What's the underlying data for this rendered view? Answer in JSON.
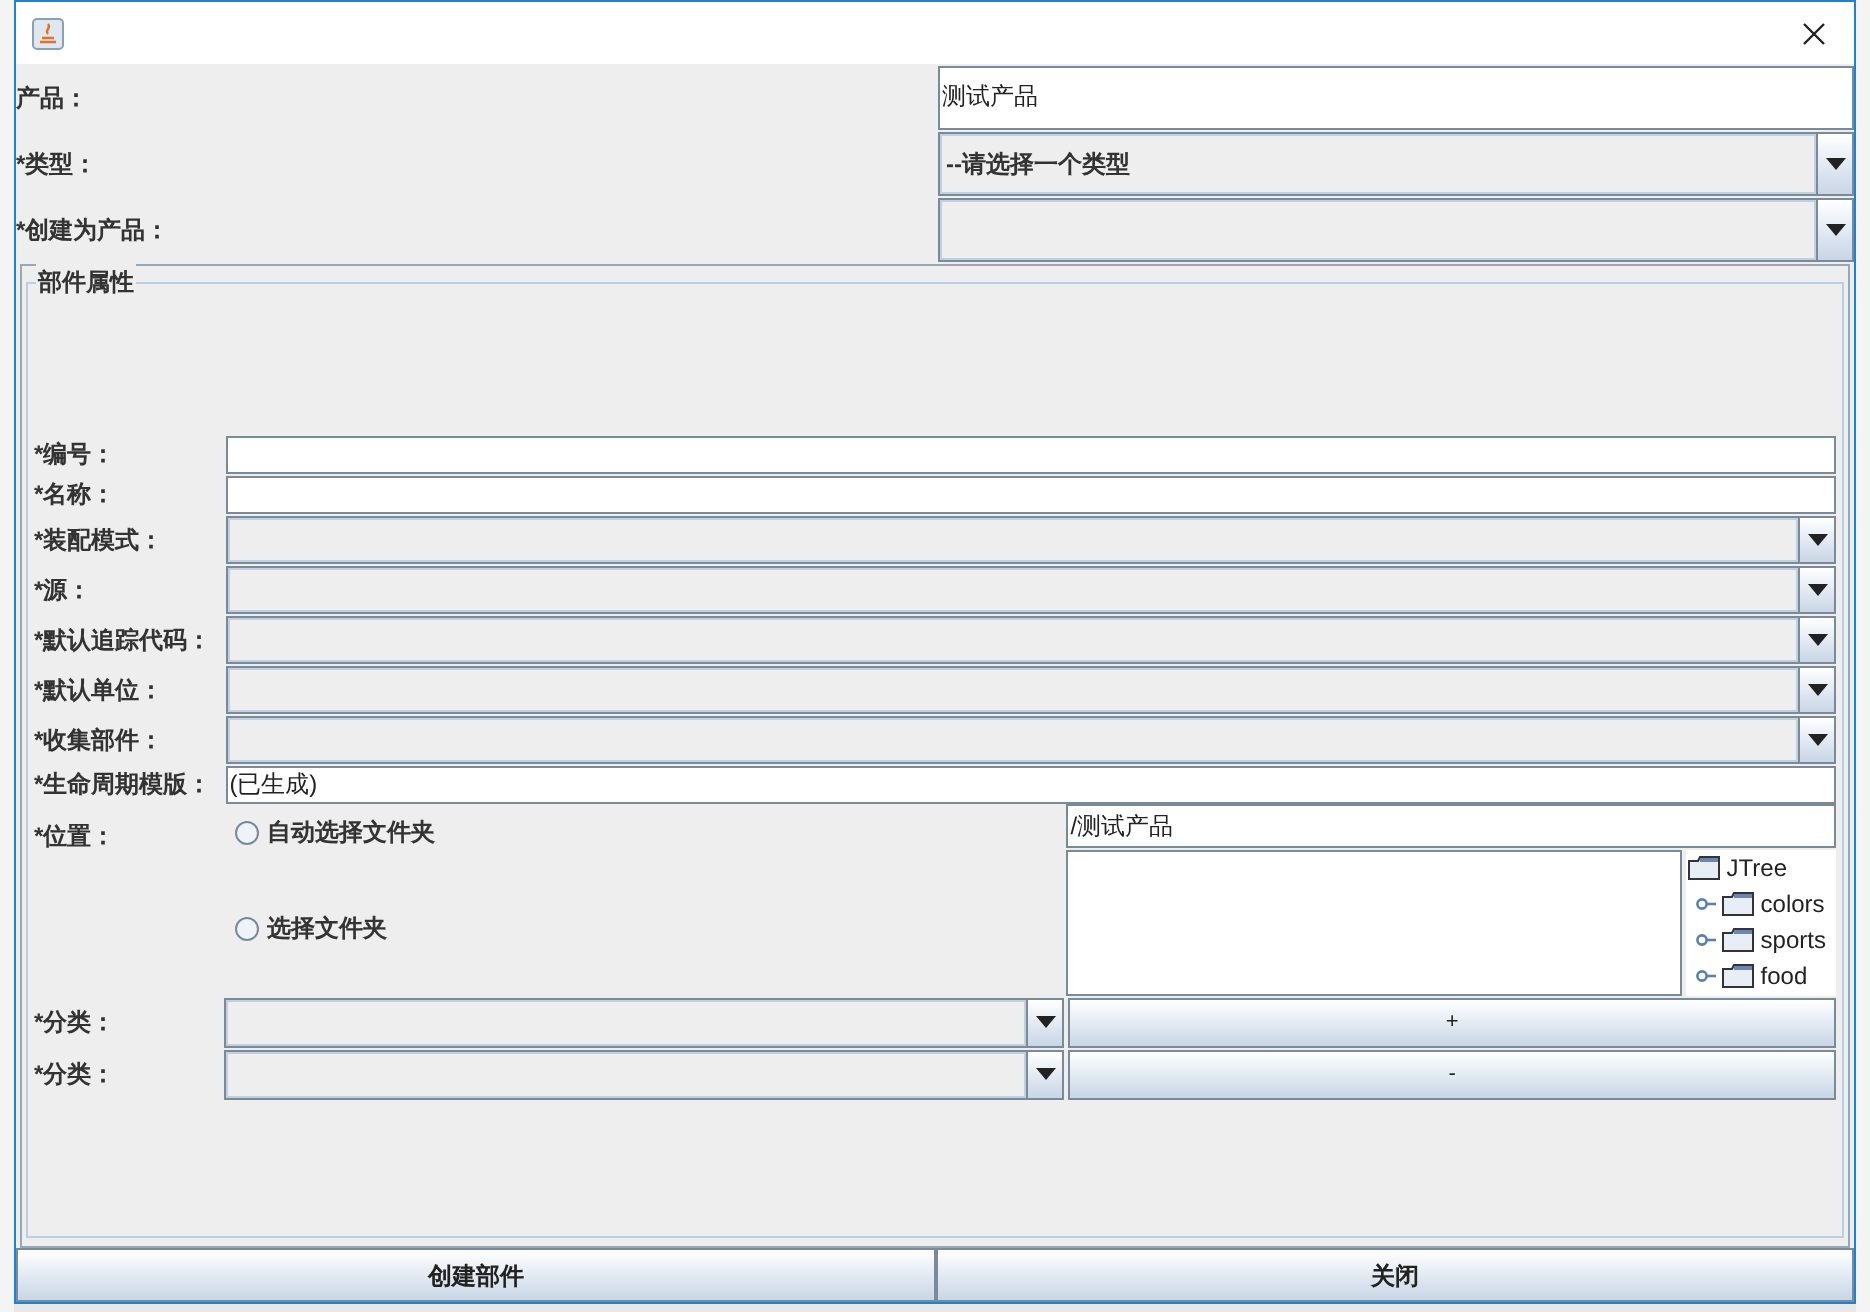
{
  "header_fields": [
    {
      "kind": "text",
      "label": "产品：",
      "value": "测试产品"
    },
    {
      "kind": "combo",
      "label": "*类型：",
      "value": "--请选择一个类型"
    },
    {
      "kind": "combo",
      "label": "*创建为产品："
    }
  ],
  "panel": {
    "title": "部件属性",
    "fields": [
      {
        "kind": "text",
        "label": "*编号："
      },
      {
        "kind": "text",
        "label": "*名称："
      },
      {
        "kind": "combo",
        "label": "*装配模式："
      },
      {
        "kind": "combo",
        "label": "*源："
      },
      {
        "kind": "combo",
        "label": "*默认追踪代码："
      },
      {
        "kind": "combo",
        "label": "*默认单位："
      },
      {
        "kind": "combo",
        "label": "*收集部件："
      },
      {
        "kind": "text",
        "label": "*生命周期模版：",
        "value": "(已生成)"
      }
    ],
    "location": {
      "label": "*位置：",
      "options": [
        {
          "label": "自动选择文件夹",
          "selected": false
        },
        {
          "label": "选择文件夹",
          "selected": false
        }
      ],
      "path": "/测试产品",
      "tree": {
        "label": "JTree",
        "children": [
          {
            "label": "colors"
          },
          {
            "label": "sports"
          },
          {
            "label": "food"
          }
        ]
      }
    },
    "categories": [
      {
        "label": "*分类：",
        "button": "+"
      },
      {
        "label": "*分类：",
        "button": "-"
      }
    ]
  },
  "buttons": [
    "创建部件",
    "关闭"
  ]
}
